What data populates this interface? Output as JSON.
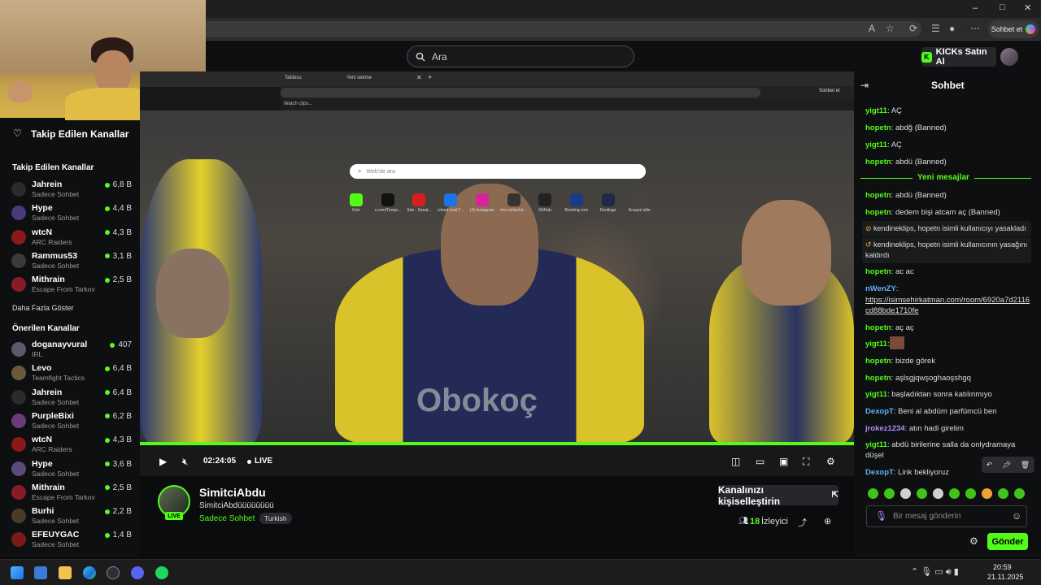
{
  "browser": {
    "sohbet_label": "Sohbet et",
    "window_controls": [
      "–",
      "□",
      "✕"
    ]
  },
  "header": {
    "search_placeholder": "Ara",
    "kicks_label": "KICKs Satın Al"
  },
  "sidebar": {
    "followed_title": "Takip Edilen Kanallar",
    "followed_section": "Takip Edilen Kanallar",
    "followed": [
      {
        "name": "Jahrein",
        "game": "Sadece Sohbet",
        "viewers": "6,8 B"
      },
      {
        "name": "Hype",
        "game": "Sadece Sohbet",
        "viewers": "4,4 B"
      },
      {
        "name": "wtcN",
        "game": "ARC Raiders",
        "viewers": "4,3 B"
      },
      {
        "name": "Rammus53",
        "game": "Sadece Sohbet",
        "viewers": "3,1 B"
      },
      {
        "name": "Mithrain",
        "game": "Escape From Tarkov",
        "viewers": "2,5 B"
      }
    ],
    "show_more": "Daha Fazla Göster",
    "recommended_section": "Önerilen Kanallar",
    "recommended": [
      {
        "name": "doganayvural",
        "game": "IRL",
        "viewers": "407"
      },
      {
        "name": "Levo",
        "game": "Teamfight Tactics",
        "viewers": "6,4 B"
      },
      {
        "name": "Jahrein",
        "game": "Sadece Sohbet",
        "viewers": "6,4 B"
      },
      {
        "name": "PurpleBixi",
        "game": "Sadece Sohbet",
        "viewers": "6,2 B"
      },
      {
        "name": "wtcN",
        "game": "ARC Raiders",
        "viewers": "4,3 B"
      },
      {
        "name": "Hype",
        "game": "Sadece Sohbet",
        "viewers": "3,6 B"
      },
      {
        "name": "Mithrain",
        "game": "Escape From Tarkov",
        "viewers": "2,5 B"
      },
      {
        "name": "Burhi",
        "game": "Sadece Sohbet",
        "viewers": "2,2 B"
      },
      {
        "name": "EFEUYGAC",
        "game": "Sadece Sohbet",
        "viewers": "1,4 B"
      }
    ]
  },
  "video": {
    "inner_tab1": "Tablosu",
    "inner_tab2": "Yeni sekme",
    "inner_sohbet": "Sohbet et",
    "inner_bookmark": "Watch clips...",
    "inner_search": "Web'de ara",
    "quick_links": [
      "Kick",
      "x.com/Tempi...",
      "Sdo - Sanal...",
      "icloud.mail.T...",
      "(4) Instagram",
      "lmu.rublacké...",
      "GitHub",
      "Booking.com",
      "Duolingo",
      "Kısayol ekle"
    ],
    "time": "02:24:05",
    "live_label": "LIVE",
    "jersey_text": "Obokoç"
  },
  "stream": {
    "name": "SimitciAbdu",
    "title": "SimitciAbdüüüüüüüü",
    "category": "Sadece Sohbet",
    "language": "Turkish",
    "live_badge": "LIVE",
    "customize_label": "Kanalınızı kişiselleştirin",
    "viewers_count": "18",
    "viewers_label": "İzleyici"
  },
  "chat": {
    "title": "Sohbet",
    "new_messages": "Yeni mesajlar",
    "messages": [
      {
        "user": "yigt11",
        "text": "AÇ",
        "color": "#53fc18"
      },
      {
        "user": "hopetn",
        "text": "abdğ (Banned)",
        "color": "#53fc18"
      },
      {
        "user": "yigt11",
        "text": "AÇ",
        "color": "#53fc18"
      },
      {
        "user": "hopetn",
        "text": "abdü (Banned)",
        "color": "#53fc18"
      },
      {
        "user": "hopetn",
        "text": "abdü (Banned)",
        "color": "#53fc18"
      },
      {
        "user": "hopetn",
        "text": "dedem bişi atcam aç (Banned)",
        "color": "#53fc18"
      }
    ],
    "sys1": "kendineklips, hopetn isimli kullanıcıyı yasakladı",
    "sys2": "kendineklips, hopetn isimli kullanıcının yasağını kaldırdı",
    "messages2": [
      {
        "user": "hopetn",
        "text": "ac ac",
        "color": "#53fc18"
      },
      {
        "user": "nWenZY",
        "text": "",
        "color": "#5fb3ff"
      },
      {
        "user": "",
        "text": "https://isimsehirkatman.com/room/6920a7d2116cd88bde1710fe",
        "color": "#ddd"
      },
      {
        "user": "hopetn",
        "text": "aç aç",
        "color": "#53fc18"
      },
      {
        "user": "yigt11",
        "text": "",
        "color": "#53fc18"
      },
      {
        "user": "hopetn",
        "text": "bizde görek",
        "color": "#53fc18"
      },
      {
        "user": "hopetn",
        "text": "aşlsgjqwşoghaoşshgq",
        "color": "#53fc18"
      },
      {
        "user": "yigt11",
        "text": "başladıktan sonra katılınmıyo",
        "color": "#53fc18"
      },
      {
        "user": "DexopT",
        "text": "Beni al abdüm parfümcü ben",
        "color": "#5fb3ff"
      },
      {
        "user": "jrokez1234",
        "text": "atın hadi girelim",
        "color": "#b58cff"
      },
      {
        "user": "yigt11",
        "text": "abdü birilerine salla da onlydramaya düşel",
        "color": "#53fc18"
      },
      {
        "user": "DexopT",
        "text": "Link bekliyoruz",
        "color": "#5fb3ff"
      }
    ],
    "input_placeholder": "Bir mesaj gönderin",
    "send_label": "Gönder"
  },
  "taskbar": {
    "time": "20:59",
    "date": "21.11.2025"
  },
  "colors": {
    "accent": "#53fc18",
    "background": "#0b0c0d"
  }
}
